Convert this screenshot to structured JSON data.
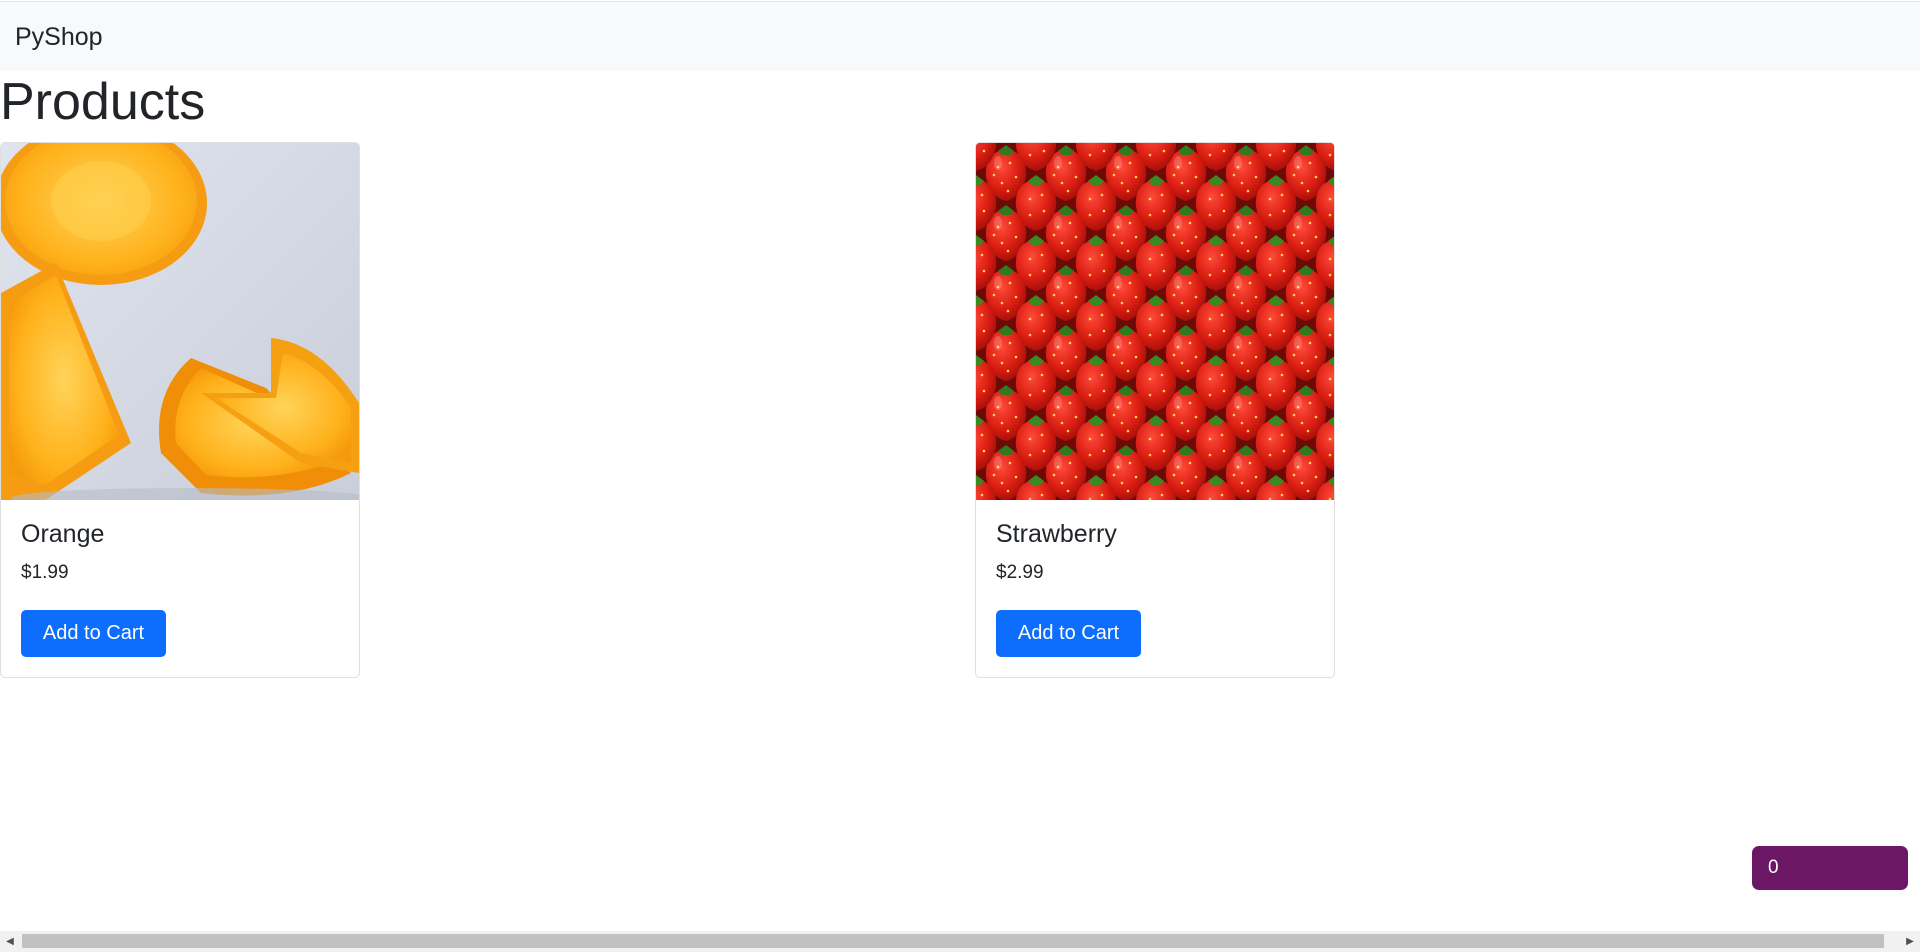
{
  "navbar": {
    "brand": "PyShop"
  },
  "page": {
    "title": "Products"
  },
  "products": [
    {
      "name": "Orange",
      "price": "$1.99",
      "button_label": "Add to Cart",
      "image_alt": "Orange slices"
    },
    {
      "name": "Strawberry",
      "price": "$2.99",
      "button_label": "Add to Cart",
      "image_alt": "Strawberries"
    }
  ],
  "cart": {
    "count": "0"
  },
  "colors": {
    "primary_button": "#0d6efd",
    "navbar_bg": "#f8f9fa",
    "cart_badge_bg": "#6b1766"
  },
  "icons": {
    "scroll_left": "scroll-left-arrow-icon",
    "scroll_right": "scroll-right-arrow-icon"
  }
}
